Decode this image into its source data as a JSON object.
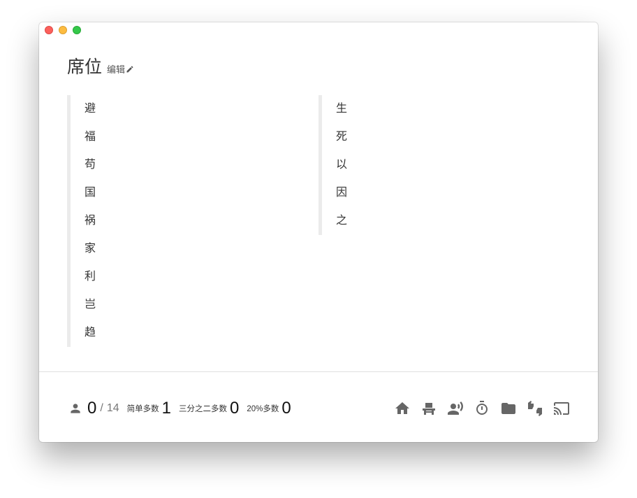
{
  "header": {
    "title": "席位",
    "edit_label": "编辑"
  },
  "columns": {
    "left": [
      "避",
      "福",
      "苟",
      "国",
      "祸",
      "家",
      "利",
      "岂",
      "趋"
    ],
    "right": [
      "生",
      "死",
      "以",
      "因",
      "之"
    ]
  },
  "footer": {
    "present_count": "0",
    "separator": "/",
    "total_count": "14",
    "simple_majority_label": "简单多数",
    "simple_majority_value": "1",
    "two_thirds_label": "三分之二多数",
    "two_thirds_value": "0",
    "twenty_percent_label": "20%多数",
    "twenty_percent_value": "0"
  },
  "toolbar_icons": [
    "home-icon",
    "seat-icon",
    "speaker-icon",
    "timer-icon",
    "folder-icon",
    "vote-icon",
    "cast-icon"
  ],
  "colors": {
    "icon": "#666666",
    "column_border": "#ebebeb",
    "divider": "#e0e0e0"
  }
}
